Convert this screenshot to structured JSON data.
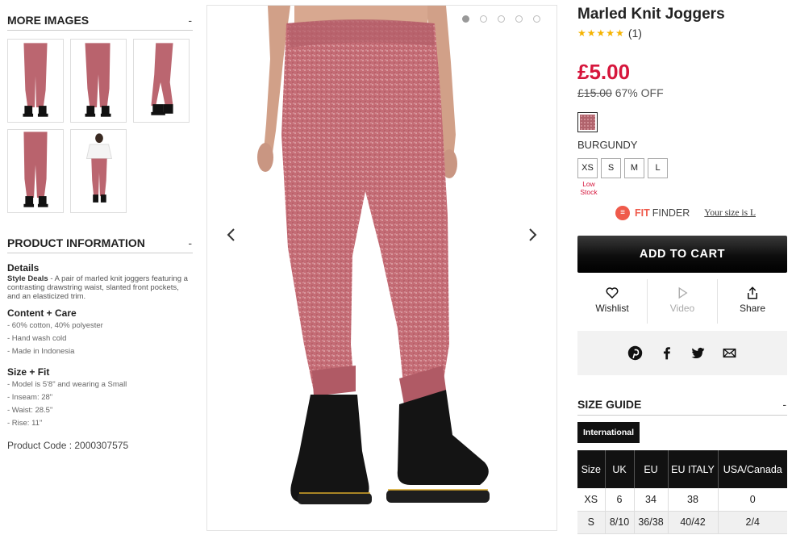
{
  "more_images": {
    "title": "MORE IMAGES",
    "toggle": "-",
    "thumbnails": 5
  },
  "product_info": {
    "title": "PRODUCT INFORMATION",
    "toggle": "-",
    "details_heading": "Details",
    "details_label": "Style Deals",
    "details_text": " - A pair of marled knit joggers featuring a contrasting drawstring waist, slanted front pockets, and an elasticized trim.",
    "content_heading": "Content + Care",
    "content_items": [
      "- 60% cotton, 40% polyester",
      "- Hand wash cold",
      "- Made in Indonesia"
    ],
    "size_heading": "Size + Fit",
    "size_items": [
      "- Model is 5'8\" and wearing a Small",
      "- Inseam: 28\"",
      "- Waist: 28.5\"",
      "- Rise: 11\""
    ],
    "product_code": "Product Code : 2000307575"
  },
  "gallery": {
    "slides": 5,
    "active_slide": 1,
    "prev_icon": "chevron-left-icon",
    "next_icon": "chevron-right-icon"
  },
  "product": {
    "name": "Marled Knit Joggers",
    "rating_stars": 5,
    "rating_count": "(1)",
    "price": "£5.00",
    "old_price": "£15.00",
    "discount": "67% OFF",
    "color_name": "BURGUNDY",
    "sizes": [
      "XS",
      "S",
      "M",
      "L"
    ],
    "low_stock_label": "Low Stock"
  },
  "fit_finder": {
    "brand_fit": "FIT",
    "brand_finder": "FINDER",
    "link": "Your size is L"
  },
  "add_to_cart": "ADD TO CART",
  "actions": {
    "wishlist": "Wishlist",
    "video": "Video",
    "share": "Share"
  },
  "social": [
    "pinterest-icon",
    "facebook-icon",
    "twitter-icon",
    "email-icon"
  ],
  "size_guide": {
    "title": "SIZE GUIDE",
    "toggle": "-",
    "tab": "International",
    "headers": [
      "Size",
      "UK",
      "EU",
      "EU ITALY",
      "USA/Canada"
    ],
    "rows": [
      [
        "XS",
        "6",
        "34",
        "38",
        "0"
      ],
      [
        "S",
        "8/10",
        "36/38",
        "40/42",
        "2/4"
      ]
    ]
  },
  "colors": {
    "price_red": "#d6163c",
    "fit_finder": "#ef5a4b",
    "jogger": "#c06a72",
    "star": "#f5b301"
  }
}
